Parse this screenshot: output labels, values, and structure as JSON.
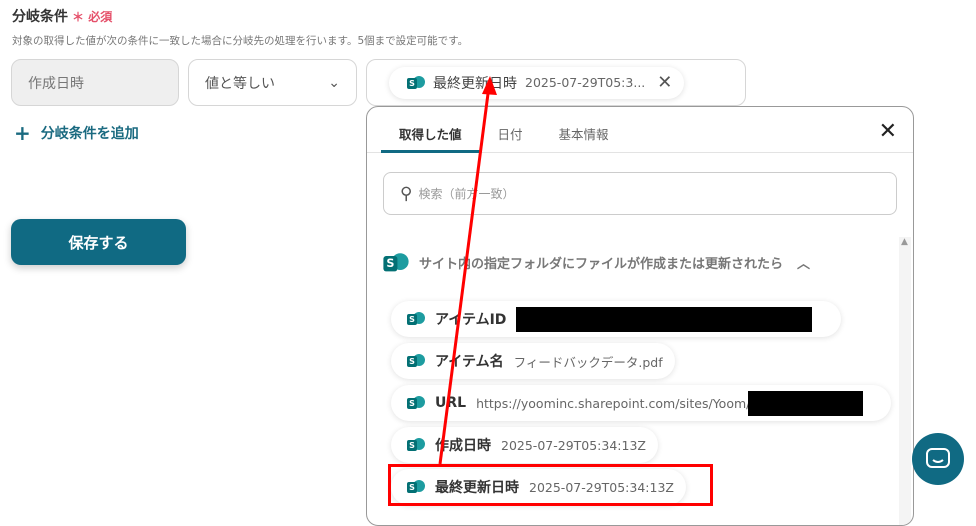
{
  "section": {
    "title": "分岐条件",
    "required_mark": "＊",
    "required": "必須",
    "description": "対象の取得した値が次の条件に一致した場合に分岐先の処理を行います。5個まで設定可能です。"
  },
  "condition": {
    "field": "作成日時",
    "operator": "値と等しい",
    "value_chip": {
      "label": "最終更新日時",
      "value": "2025-07-29T05:3..."
    }
  },
  "add_condition": "分岐条件を追加",
  "save_button": "保存する",
  "panel": {
    "tabs": [
      "取得した値",
      "日付",
      "基本情報"
    ],
    "search_placeholder": "検索（前方一致）",
    "group_title": "サイト内の指定フォルダにファイルが作成または更新されたら",
    "items": [
      {
        "label": "アイテムID",
        "value": ""
      },
      {
        "label": "アイテム名",
        "value": "フィードバックデータ.pdf"
      },
      {
        "label": "URL",
        "value": "https://yoominc.sharepoint.com/sites/Yoom/"
      },
      {
        "label": "作成日時",
        "value": "2025-07-29T05:34:13Z"
      },
      {
        "label": "最終更新日時",
        "value": "2025-07-29T05:34:13Z"
      }
    ]
  },
  "colors": {
    "accent": "#106a83",
    "required": "#e5506a",
    "annotation": "#ff0000"
  }
}
